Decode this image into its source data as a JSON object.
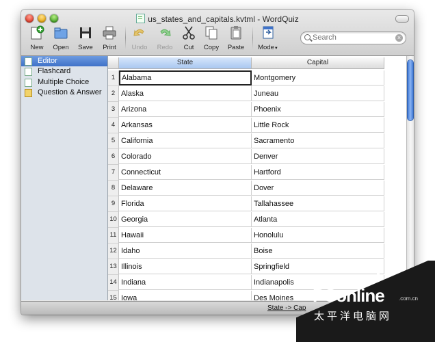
{
  "window": {
    "title": "us_states_and_capitals.kvtml - WordQuiz"
  },
  "toolbar": {
    "buttons": [
      {
        "label": "New",
        "icon": "new-document-icon",
        "enabled": true
      },
      {
        "label": "Open",
        "icon": "open-folder-icon",
        "enabled": true
      },
      {
        "label": "Save",
        "icon": "floppy-disk-icon",
        "enabled": true
      },
      {
        "label": "Print",
        "icon": "printer-icon",
        "enabled": true
      },
      {
        "label": "Undo",
        "icon": "undo-arrow-icon",
        "enabled": false
      },
      {
        "label": "Redo",
        "icon": "redo-arrow-icon",
        "enabled": false
      },
      {
        "label": "Cut",
        "icon": "scissors-icon",
        "enabled": true
      },
      {
        "label": "Copy",
        "icon": "copy-icon",
        "enabled": true
      },
      {
        "label": "Paste",
        "icon": "paste-icon",
        "enabled": true
      },
      {
        "label": "Mode",
        "icon": "mode-icon",
        "enabled": true
      }
    ]
  },
  "search": {
    "placeholder": "Search",
    "value": ""
  },
  "sidebar": {
    "items": [
      {
        "label": "Editor",
        "selected": true
      },
      {
        "label": "Flashcard",
        "selected": false
      },
      {
        "label": "Multiple Choice",
        "selected": false
      },
      {
        "label": "Question & Answer",
        "selected": false
      }
    ]
  },
  "table": {
    "columns": [
      "State",
      "Capital"
    ],
    "selected_column": "State",
    "active_cell": {
      "row": 1,
      "column": "State"
    },
    "rows": [
      {
        "n": "1",
        "state": "Alabama",
        "capital": "Montgomery"
      },
      {
        "n": "2",
        "state": "Alaska",
        "capital": "Juneau"
      },
      {
        "n": "3",
        "state": "Arizona",
        "capital": "Phoenix"
      },
      {
        "n": "4",
        "state": "Arkansas",
        "capital": "Little Rock"
      },
      {
        "n": "5",
        "state": "California",
        "capital": "Sacramento"
      },
      {
        "n": "6",
        "state": "Colorado",
        "capital": "Denver"
      },
      {
        "n": "7",
        "state": "Connecticut",
        "capital": "Hartford"
      },
      {
        "n": "8",
        "state": "Delaware",
        "capital": "Dover"
      },
      {
        "n": "9",
        "state": "Florida",
        "capital": "Tallahassee"
      },
      {
        "n": "10",
        "state": "Georgia",
        "capital": "Atlanta"
      },
      {
        "n": "11",
        "state": "Hawaii",
        "capital": "Honolulu"
      },
      {
        "n": "12",
        "state": "Idaho",
        "capital": "Boise"
      },
      {
        "n": "13",
        "state": "Illinois",
        "capital": "Springfield"
      },
      {
        "n": "14",
        "state": "Indiana",
        "capital": "Indianapolis"
      },
      {
        "n": "15",
        "state": "Iowa",
        "capital": "Des Moines"
      }
    ]
  },
  "statusbar": {
    "text": "State -> Cap"
  },
  "watermark": {
    "logo": "PConline",
    "domain": ".com.cn",
    "chinese": "太平洋电脑网"
  },
  "colors": {
    "selection_blue": "#3f72c8",
    "sidebar_bg": "#dde3ea"
  }
}
